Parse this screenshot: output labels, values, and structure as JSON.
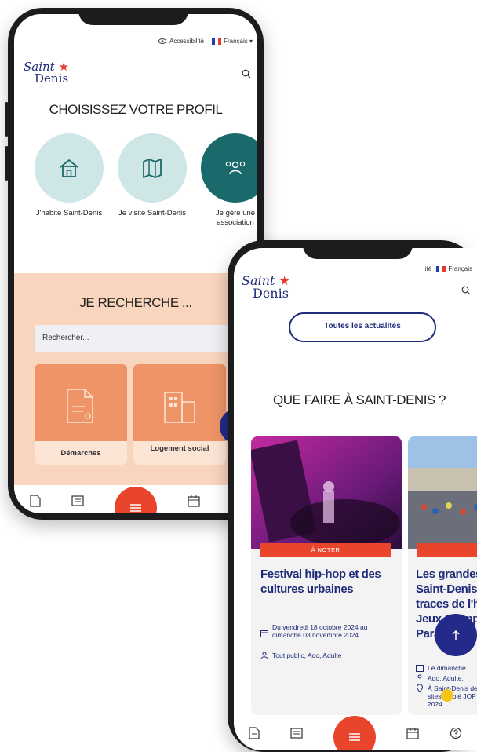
{
  "colors": {
    "navy": "#1e2a78",
    "accent_red": "#e8452c",
    "teal_light": "#cfe6e6",
    "teal_dark": "#1a6a6c",
    "peach": "#f9d5bd",
    "orange_card": "#ee9467"
  },
  "phone1": {
    "topbar": {
      "accessibility": "Accessibilité",
      "language": "Français ▾"
    },
    "logo": {
      "line1": "Saint",
      "line2": "Denis"
    },
    "profile_title": "CHOISISSEZ VOTRE PROFIL",
    "profiles": [
      {
        "label": "J'habite Saint-Denis",
        "icon": "house-icon"
      },
      {
        "label": "Je visite Saint-Denis",
        "icon": "map-icon"
      },
      {
        "label": "Je gère une association",
        "icon": "group-icon"
      }
    ],
    "search_title": "JE RECHERCHE ...",
    "search_placeholder": "Rechercher...",
    "tiles": [
      {
        "label": "Démarches",
        "icon": "document-icon"
      },
      {
        "label": "Logement social",
        "icon": "building-icon"
      }
    ]
  },
  "phone2": {
    "topbar": {
      "accessibility": "lité",
      "language": "Français"
    },
    "logo": {
      "line1": "Saint",
      "line2": "Denis"
    },
    "all_news_button": "Toutes les actualités",
    "events_title": "QUE FAIRE À SAINT-DENIS ?",
    "events": [
      {
        "tag": "À NOTER",
        "title": "Festival hip-hop et des cultures urbaines",
        "date": "Du vendredi 18 octobre 2024 au dimanche 03 novembre 2024",
        "audience": "Tout public, Ado, Adulte"
      },
      {
        "tag": "",
        "title": "Les grandes Saint-Denis traces de l'h Jeux Olympi Para",
        "date": "Le dimanche",
        "audience": "Ado, Adulte,",
        "location": "À Saint-Denis des sites emblé JOP 2024"
      }
    ],
    "bottom_nav": [
      "document-icon",
      "news-icon",
      "menu-icon",
      "calendar-icon",
      "help-icon"
    ]
  }
}
